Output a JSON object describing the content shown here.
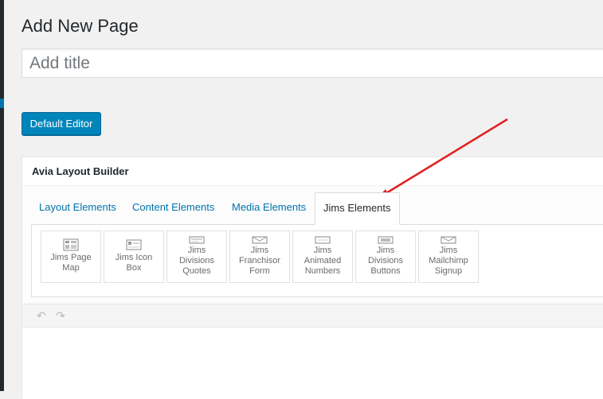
{
  "page": {
    "title": "Add New Page",
    "title_placeholder": "Add title",
    "default_editor_label": "Default Editor"
  },
  "builder": {
    "header": "Avia Layout Builder",
    "tabs": [
      {
        "label": "Layout Elements"
      },
      {
        "label": "Content Elements"
      },
      {
        "label": "Media Elements"
      },
      {
        "label": "Jims Elements",
        "active": true
      }
    ],
    "elements": [
      {
        "line1": "Jims Page",
        "line2": "Map",
        "icon": "sitemap-icon"
      },
      {
        "line1": "Jims Icon",
        "line2": "Box",
        "icon": "icon-box-icon"
      },
      {
        "line1": "Jims",
        "line2": "Divisions",
        "line3": "Quotes",
        "icon": "quotes-icon"
      },
      {
        "line1": "Jims",
        "line2": "Franchisor",
        "line3": "Form",
        "icon": "form-icon"
      },
      {
        "line1": "Jims",
        "line2": "Animated",
        "line3": "Numbers",
        "icon": "numbers-icon"
      },
      {
        "line1": "Jims",
        "line2": "Divisions",
        "line3": "Buttons",
        "icon": "buttons-icon"
      },
      {
        "line1": "Jims",
        "line2": "Mailchimp",
        "line3": "Signup",
        "icon": "signup-icon"
      }
    ],
    "undo_icon": "undo-icon",
    "redo_icon": "redo-icon"
  },
  "colors": {
    "accent": "#0085ba",
    "link": "#0073aa",
    "arrow": "#e02020"
  }
}
